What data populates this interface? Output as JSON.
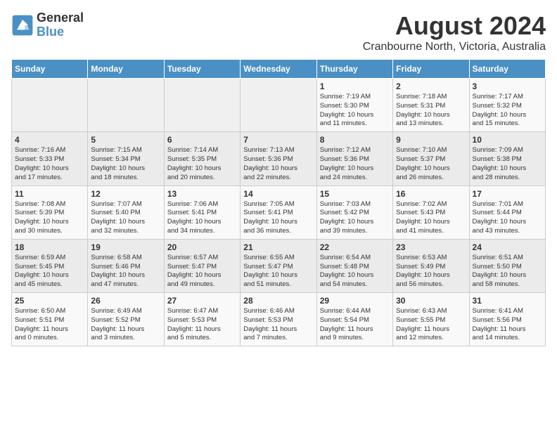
{
  "logo": {
    "line1": "General",
    "line2": "Blue"
  },
  "title": "August 2024",
  "subtitle": "Cranbourne North, Victoria, Australia",
  "days_of_week": [
    "Sunday",
    "Monday",
    "Tuesday",
    "Wednesday",
    "Thursday",
    "Friday",
    "Saturday"
  ],
  "weeks": [
    [
      {
        "day": "",
        "content": ""
      },
      {
        "day": "",
        "content": ""
      },
      {
        "day": "",
        "content": ""
      },
      {
        "day": "",
        "content": ""
      },
      {
        "day": "1",
        "content": "Sunrise: 7:19 AM\nSunset: 5:30 PM\nDaylight: 10 hours\nand 11 minutes."
      },
      {
        "day": "2",
        "content": "Sunrise: 7:18 AM\nSunset: 5:31 PM\nDaylight: 10 hours\nand 13 minutes."
      },
      {
        "day": "3",
        "content": "Sunrise: 7:17 AM\nSunset: 5:32 PM\nDaylight: 10 hours\nand 15 minutes."
      }
    ],
    [
      {
        "day": "4",
        "content": "Sunrise: 7:16 AM\nSunset: 5:33 PM\nDaylight: 10 hours\nand 17 minutes."
      },
      {
        "day": "5",
        "content": "Sunrise: 7:15 AM\nSunset: 5:34 PM\nDaylight: 10 hours\nand 18 minutes."
      },
      {
        "day": "6",
        "content": "Sunrise: 7:14 AM\nSunset: 5:35 PM\nDaylight: 10 hours\nand 20 minutes."
      },
      {
        "day": "7",
        "content": "Sunrise: 7:13 AM\nSunset: 5:36 PM\nDaylight: 10 hours\nand 22 minutes."
      },
      {
        "day": "8",
        "content": "Sunrise: 7:12 AM\nSunset: 5:36 PM\nDaylight: 10 hours\nand 24 minutes."
      },
      {
        "day": "9",
        "content": "Sunrise: 7:10 AM\nSunset: 5:37 PM\nDaylight: 10 hours\nand 26 minutes."
      },
      {
        "day": "10",
        "content": "Sunrise: 7:09 AM\nSunset: 5:38 PM\nDaylight: 10 hours\nand 28 minutes."
      }
    ],
    [
      {
        "day": "11",
        "content": "Sunrise: 7:08 AM\nSunset: 5:39 PM\nDaylight: 10 hours\nand 30 minutes."
      },
      {
        "day": "12",
        "content": "Sunrise: 7:07 AM\nSunset: 5:40 PM\nDaylight: 10 hours\nand 32 minutes."
      },
      {
        "day": "13",
        "content": "Sunrise: 7:06 AM\nSunset: 5:41 PM\nDaylight: 10 hours\nand 34 minutes."
      },
      {
        "day": "14",
        "content": "Sunrise: 7:05 AM\nSunset: 5:41 PM\nDaylight: 10 hours\nand 36 minutes."
      },
      {
        "day": "15",
        "content": "Sunrise: 7:03 AM\nSunset: 5:42 PM\nDaylight: 10 hours\nand 39 minutes."
      },
      {
        "day": "16",
        "content": "Sunrise: 7:02 AM\nSunset: 5:43 PM\nDaylight: 10 hours\nand 41 minutes."
      },
      {
        "day": "17",
        "content": "Sunrise: 7:01 AM\nSunset: 5:44 PM\nDaylight: 10 hours\nand 43 minutes."
      }
    ],
    [
      {
        "day": "18",
        "content": "Sunrise: 6:59 AM\nSunset: 5:45 PM\nDaylight: 10 hours\nand 45 minutes."
      },
      {
        "day": "19",
        "content": "Sunrise: 6:58 AM\nSunset: 5:46 PM\nDaylight: 10 hours\nand 47 minutes."
      },
      {
        "day": "20",
        "content": "Sunrise: 6:57 AM\nSunset: 5:47 PM\nDaylight: 10 hours\nand 49 minutes."
      },
      {
        "day": "21",
        "content": "Sunrise: 6:55 AM\nSunset: 5:47 PM\nDaylight: 10 hours\nand 51 minutes."
      },
      {
        "day": "22",
        "content": "Sunrise: 6:54 AM\nSunset: 5:48 PM\nDaylight: 10 hours\nand 54 minutes."
      },
      {
        "day": "23",
        "content": "Sunrise: 6:53 AM\nSunset: 5:49 PM\nDaylight: 10 hours\nand 56 minutes."
      },
      {
        "day": "24",
        "content": "Sunrise: 6:51 AM\nSunset: 5:50 PM\nDaylight: 10 hours\nand 58 minutes."
      }
    ],
    [
      {
        "day": "25",
        "content": "Sunrise: 6:50 AM\nSunset: 5:51 PM\nDaylight: 11 hours\nand 0 minutes."
      },
      {
        "day": "26",
        "content": "Sunrise: 6:49 AM\nSunset: 5:52 PM\nDaylight: 11 hours\nand 3 minutes."
      },
      {
        "day": "27",
        "content": "Sunrise: 6:47 AM\nSunset: 5:53 PM\nDaylight: 11 hours\nand 5 minutes."
      },
      {
        "day": "28",
        "content": "Sunrise: 6:46 AM\nSunset: 5:53 PM\nDaylight: 11 hours\nand 7 minutes."
      },
      {
        "day": "29",
        "content": "Sunrise: 6:44 AM\nSunset: 5:54 PM\nDaylight: 11 hours\nand 9 minutes."
      },
      {
        "day": "30",
        "content": "Sunrise: 6:43 AM\nSunset: 5:55 PM\nDaylight: 11 hours\nand 12 minutes."
      },
      {
        "day": "31",
        "content": "Sunrise: 6:41 AM\nSunset: 5:56 PM\nDaylight: 11 hours\nand 14 minutes."
      }
    ]
  ]
}
